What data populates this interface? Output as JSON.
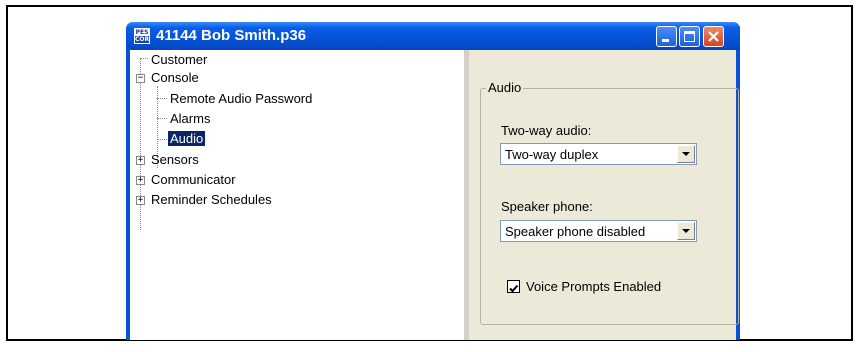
{
  "window": {
    "title": "41144 Bob Smith.p36",
    "icon_text_top": "PES",
    "icon_text_bottom": "COR"
  },
  "tree": {
    "items": [
      {
        "label": "Customer",
        "expander": ""
      },
      {
        "label": "Console",
        "expander": "−"
      },
      {
        "label": "Remote Audio Password",
        "expander": ""
      },
      {
        "label": "Alarms",
        "expander": ""
      },
      {
        "label": "Audio",
        "expander": "",
        "selected": true
      },
      {
        "label": "Sensors",
        "expander": "+"
      },
      {
        "label": "Communicator",
        "expander": "+"
      },
      {
        "label": "Reminder Schedules",
        "expander": "+"
      }
    ]
  },
  "panel": {
    "group_label": "Audio",
    "two_way_label": "Two-way audio:",
    "two_way_value": "Two-way duplex",
    "speaker_label": "Speaker phone:",
    "speaker_value": "Speaker phone disabled",
    "voice_prompts_label": "Voice Prompts Enabled",
    "voice_prompts_checked": true
  }
}
